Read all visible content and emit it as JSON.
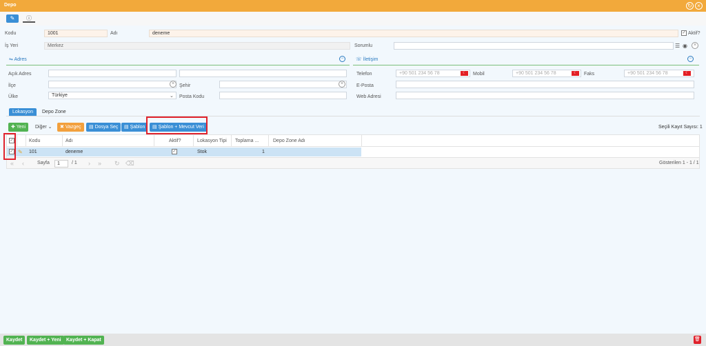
{
  "window": {
    "title": "Depo"
  },
  "header": {
    "kodu_label": "Kodu",
    "kodu_value": "1001",
    "adi_label": "Adı",
    "adi_value": "deneme",
    "aktif_label": "Aktif?",
    "isyeri_label": "İş Yeri",
    "isyeri_value": "Merkez",
    "sorumlu_label": "Sorumlu"
  },
  "adres": {
    "title": "Adres",
    "acik_adres_label": "Açık Adres",
    "ilce_label": "İlçe",
    "sehir_label": "Şehir",
    "ulke_label": "Ülke",
    "ulke_value": "Türkiye",
    "posta_kodu_label": "Posta Kodu"
  },
  "iletisim": {
    "title": "İletişim",
    "telefon_label": "Telefon",
    "mobil_label": "Mobil",
    "faks_label": "Faks",
    "phone_placeholder": "+90 501 234 56 78",
    "eposta_label": "E-Posta",
    "web_label": "Web Adresi"
  },
  "tabs": [
    "Lokasyon",
    "Depo Zone"
  ],
  "grid_toolbar": {
    "yeni": "Yeni",
    "diger": "Diğer",
    "vazgec": "Vazgeç",
    "dosya_sec": "Dosya Seç",
    "sablon": "Şablon",
    "sablon_mevcut": "Şablon + Mevcut Veri",
    "selected_count": "Seçili Kayıt Sayısı: 1"
  },
  "grid": {
    "columns": [
      "Kodu",
      "Adı",
      "Aktif?",
      "Lokasyon Tipi",
      "Toplama ...",
      "Depo Zone Adı"
    ],
    "rows": [
      {
        "kodu": "101",
        "adi": "deneme",
        "aktif": true,
        "lokasyon_tipi": "Stok",
        "toplama": "1",
        "depo_zone": ""
      }
    ]
  },
  "pager": {
    "page_label": "Sayfa",
    "page_value": "1",
    "page_total": "/ 1",
    "showing": "Gösterilen 1 - 1 / 1"
  },
  "footer": {
    "kaydet": "Kaydet",
    "kaydet_yeni": "Kaydet + Yeni",
    "kaydet_kapat": "Kaydet + Kapat"
  },
  "colors": {
    "titlebar": "#f2a93b",
    "primary": "#3a8fd6",
    "success": "#52b352",
    "warning": "#f2a03d",
    "highlight_border": "#e0212b",
    "selected_row": "#cce3f5"
  }
}
